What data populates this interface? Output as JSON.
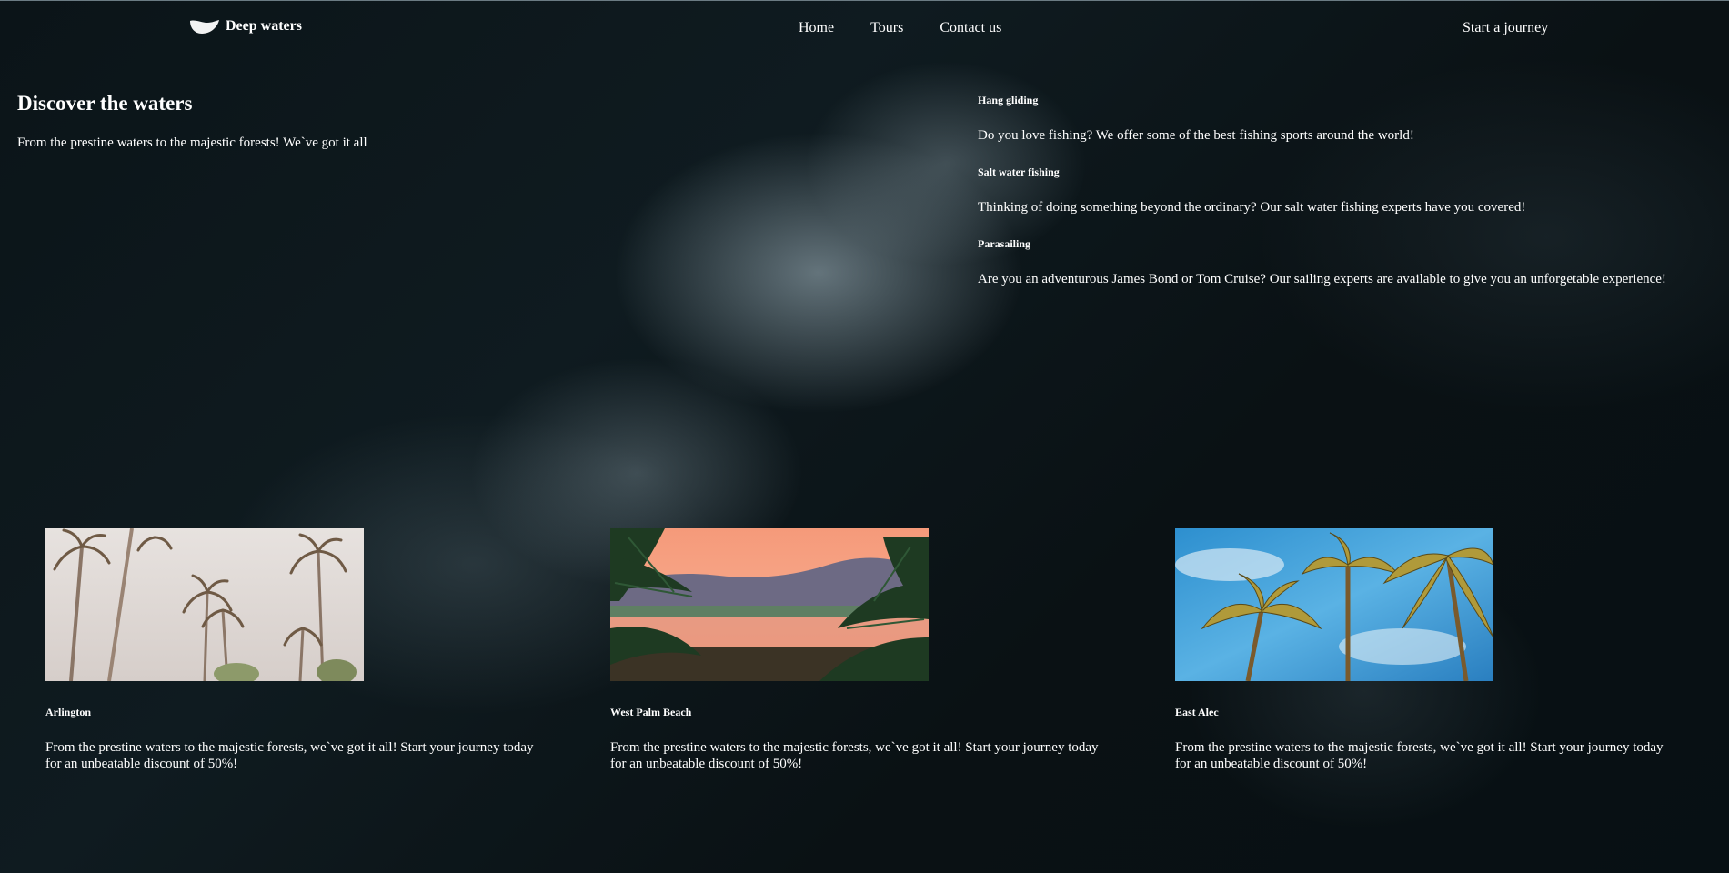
{
  "brand": {
    "logo_icon": "wave-leaf-icon",
    "name": "Deep waters"
  },
  "nav": {
    "items": [
      {
        "label": "Home"
      },
      {
        "label": "Tours"
      },
      {
        "label": "Contact us"
      }
    ],
    "cta_label": "Start a journey"
  },
  "hero": {
    "title": "Discover the waters",
    "subtitle": "From the prestine waters to the majestic forests! We`ve got it all"
  },
  "activities": [
    {
      "title": "Hang gliding",
      "description": "Do you love fishing? We offer some of the best fishing sports around the world!"
    },
    {
      "title": "Salt water fishing",
      "description": "Thinking of doing something beyond the ordinary? Our salt water fishing experts have you covered!"
    },
    {
      "title": "Parasailing",
      "description": "Are you an adventurous James Bond or Tom Cruise? Our sailing experts are available to give you an unforgetable experience!"
    }
  ],
  "destinations": [
    {
      "name": "Arlington",
      "description": "From the prestine waters to the majestic forests, we`ve got it all! Start your journey today for an unbeatable discount of 50%!",
      "image_icon": "palm-trees-hazy-sky-image"
    },
    {
      "name": "West Palm Beach",
      "description": "From the prestine waters to the majestic forests, we`ve got it all! Start your journey today for an unbeatable discount of 50%!",
      "image_icon": "sunset-lake-palms-image"
    },
    {
      "name": "East Alec",
      "description": "From the prestine waters to the majestic forests, we`ve got it all! Start your journey today for an unbeatable discount of 50%!",
      "image_icon": "palm-trees-blue-sky-image"
    }
  ],
  "colors": {
    "background": "#0b1418",
    "text": "#ffffff"
  }
}
